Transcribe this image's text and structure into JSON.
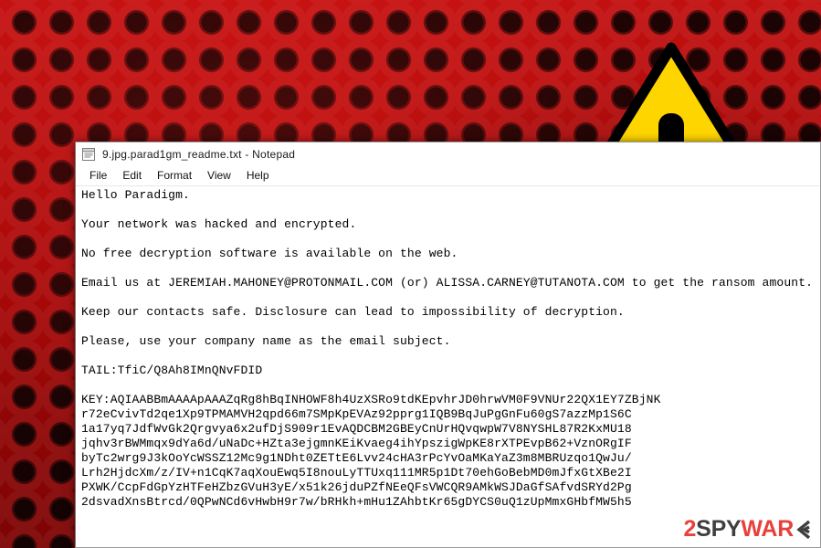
{
  "desktop": {
    "wallpaper_color": "#b50b0b",
    "warning_icon": {
      "name": "warning-triangle-icon",
      "fill": "#FFD500",
      "stroke": "#000000",
      "symbol": "!"
    }
  },
  "notepad": {
    "title": "9.jpg.parad1gm_readme.txt - Notepad",
    "icon_name": "notepad-icon",
    "menu": [
      {
        "label": "File"
      },
      {
        "label": "Edit"
      },
      {
        "label": "Format"
      },
      {
        "label": "View"
      },
      {
        "label": "Help"
      }
    ],
    "content": "Hello Paradigm.\n\nYour network was hacked and encrypted.\n\nNo free decryption software is available on the web.\n\nEmail us at JEREMIAH.MAHONEY@PROTONMAIL.COM (or) ALISSA.CARNEY@TUTANOTA.COM to get the ransom amount.\n\nKeep our contacts safe. Disclosure can lead to impossibility of decryption.\n\nPlease, use your company name as the email subject.\n\nTAIL:TfiC/Q8Ah8IMnQNvFDID\n\nKEY:AQIAABBmAAAApAAAZqRg8hBqINHOWF8h4UzXSRo9tdKEpvhrJD0hrwVM0F9VNUr22QX1EY7ZBjNK\nr72eCvivTd2qe1Xp9TPMAMVH2qpd66m7SMpKpEVAz92pprg1IQB9BqJuPgGnFu60gS7azzMp1S6C\n1a17yq7JdfWvGk2Qrgvya6x2ufDjS909r1EvAQDCBM2GBEyCnUrHQvqwpW7V8NYSHL87R2KxMU18\njqhv3rBWMmqx9dYa6d/uNaDc+HZta3ejgmnKEiKvaeg4ihYpszigWpKE8rXTPEvpB62+VznORgIF\nbyTc2wrg9J3kOoYcWSSZ12Mc9g1NDht0ZETtE6Lvv24cHA3rPcYvOaMKaYaZ3m8MBRUzqo1QwJu/\nLrh2HjdcXm/z/IV+n1CqK7aqXouEwq5I8nouLyTTUxq111MR5p1Dt70ehGoBebMD0mJfxGtXBe2I\nPXWK/CcpFdGpYzHTFeHZbzGVuH3yE/x51k26jduPZfNEeQFsVWCQR9AMkWSJDaGfSAfvdSRYd2Pg\n2dsvadXnsBtrcd/0QPwNCd6vHwbH9r7w/bRHkh+mHu1ZAhbtKr65gDYCS0uQ1zUpMmxGHbfMW5h5"
  },
  "watermark": {
    "part1": "2",
    "part2": "SPY",
    "part3": "WAR",
    "part4": "E",
    "name": "2spyware-logo",
    "color_accent": "#e8403a",
    "color_dark": "#3f3f3f"
  }
}
